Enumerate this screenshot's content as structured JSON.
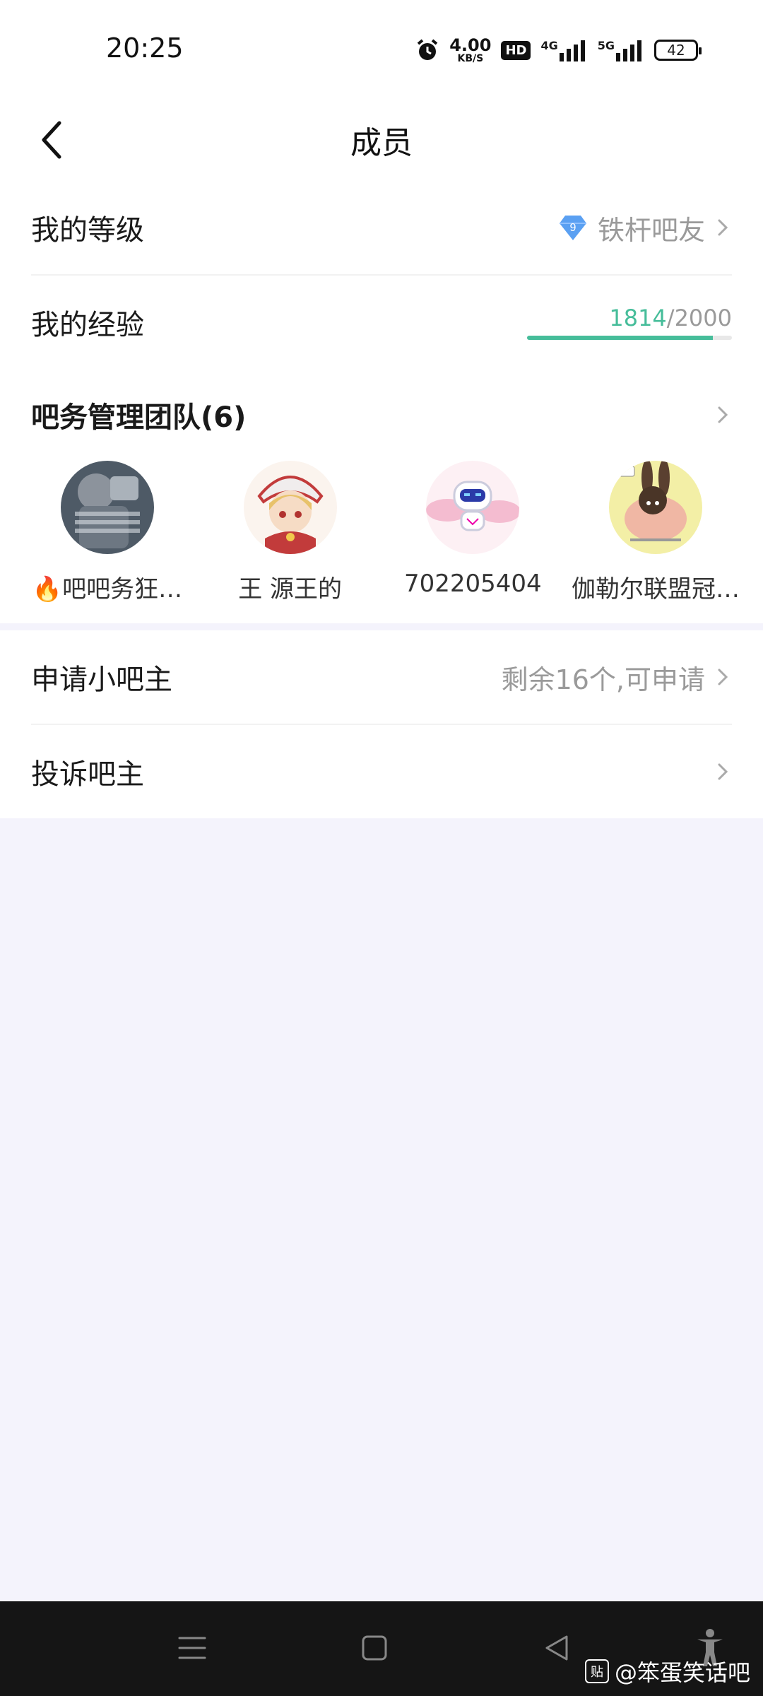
{
  "status_bar": {
    "time": "20:25",
    "speed_value": "4.00",
    "speed_unit": "KB/S",
    "hd_label": "HD",
    "net1": "4G",
    "net2": "5G",
    "battery": "42"
  },
  "header": {
    "title": "成员"
  },
  "my_info": {
    "level_label": "我的等级",
    "level_num": "9",
    "level_name": "铁杆吧友",
    "exp_label": "我的经验",
    "exp_current": "1814",
    "exp_separator": "/",
    "exp_total": "2000",
    "exp_progress": 0.907
  },
  "team": {
    "title": "吧务管理团队",
    "count": "(6)",
    "members": [
      {
        "name": "🔥吧吧务狂…"
      },
      {
        "name": "王 源王的"
      },
      {
        "name": "702205404"
      },
      {
        "name": "伽勒尔联盟冠…"
      }
    ]
  },
  "actions": {
    "apply_label": "申请小吧主",
    "apply_status": "剩余16个,可申请",
    "complain_label": "投诉吧主"
  },
  "watermark": {
    "icon_text": "贴",
    "text": "@笨蛋笑话吧"
  },
  "colors": {
    "accent": "#46bd9a",
    "background": "#f4f3fc",
    "nav_bar": "#151515"
  }
}
